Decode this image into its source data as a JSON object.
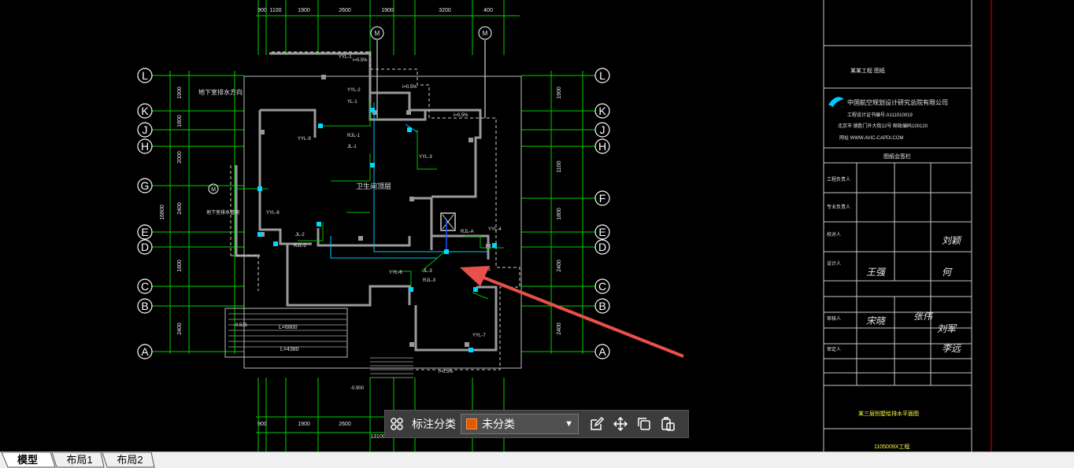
{
  "drawing": {
    "grid_labels_left": [
      "L",
      "K",
      "J",
      "H",
      "G",
      "E",
      "D",
      "C",
      "B",
      "A"
    ],
    "grid_labels_right": [
      "L",
      "K",
      "J",
      "H",
      "F",
      "E",
      "D",
      "C",
      "B",
      "A"
    ],
    "grid_labels_top": [
      "M",
      "M"
    ],
    "dim_top": [
      "900",
      "1100",
      "1900",
      "2600",
      "1900",
      "3200",
      "400"
    ],
    "dim_bottom": [
      "900",
      "1900",
      "2600",
      "13100"
    ],
    "dim_left": [
      "1900",
      "1800",
      "2000",
      "2400",
      "1800",
      "2400",
      "16800"
    ],
    "dim_right": [
      "1900",
      "1100",
      "1800",
      "2400",
      "2400"
    ],
    "pipe_labels": [
      "YYL-1",
      "YYL-2",
      "YL-1",
      "RJL-1",
      "JL-1",
      "YYL-9",
      "YYL-3",
      "YYL-8",
      "JL-2",
      "RJL-2",
      "YYL-6",
      "JL-3",
      "RJL-3",
      "RJL-A",
      "YYL-4",
      "YYL-5",
      "YYL-7"
    ],
    "notes": [
      "地下室排水方向",
      "地下室排水管",
      "地下室排水管网",
      "i=0.5%",
      "L=6800",
      "L=4380",
      "-0.535",
      "-0.900"
    ],
    "room_label": "卫生间顶层",
    "title_block": {
      "project": "某某工程 图纸",
      "company": "中国航空规划设计研究总院有限公司",
      "cert": "工程设计证书编号:A111010019",
      "address": "北京市 德胜门外大街12号  邮政编码100120",
      "web": "网址 WWW.AVIC-CAPDI.COM",
      "section": "图纸会签栏",
      "rows": [
        "工程负责人",
        "专业负责人",
        "校对人",
        "设计人",
        "审核人",
        "审定人"
      ],
      "signatures": [
        "宋晓",
        "张伟",
        "刘军",
        "王强",
        "何",
        "刘颖",
        "李远"
      ],
      "drawing_name": "某三层别墅给排水平面图",
      "drawing_no": "1105009X工程"
    }
  },
  "toolbar": {
    "grid_icon": "grid-icon",
    "label": "标注分类",
    "select_value": "未分类",
    "select_color": "#e05a00",
    "icons": [
      "edit-icon",
      "move-icon",
      "copy-icon",
      "paste-icon"
    ]
  },
  "tabs": [
    "模型",
    "布局1",
    "布局2"
  ],
  "arrow_color": "#e8504a"
}
